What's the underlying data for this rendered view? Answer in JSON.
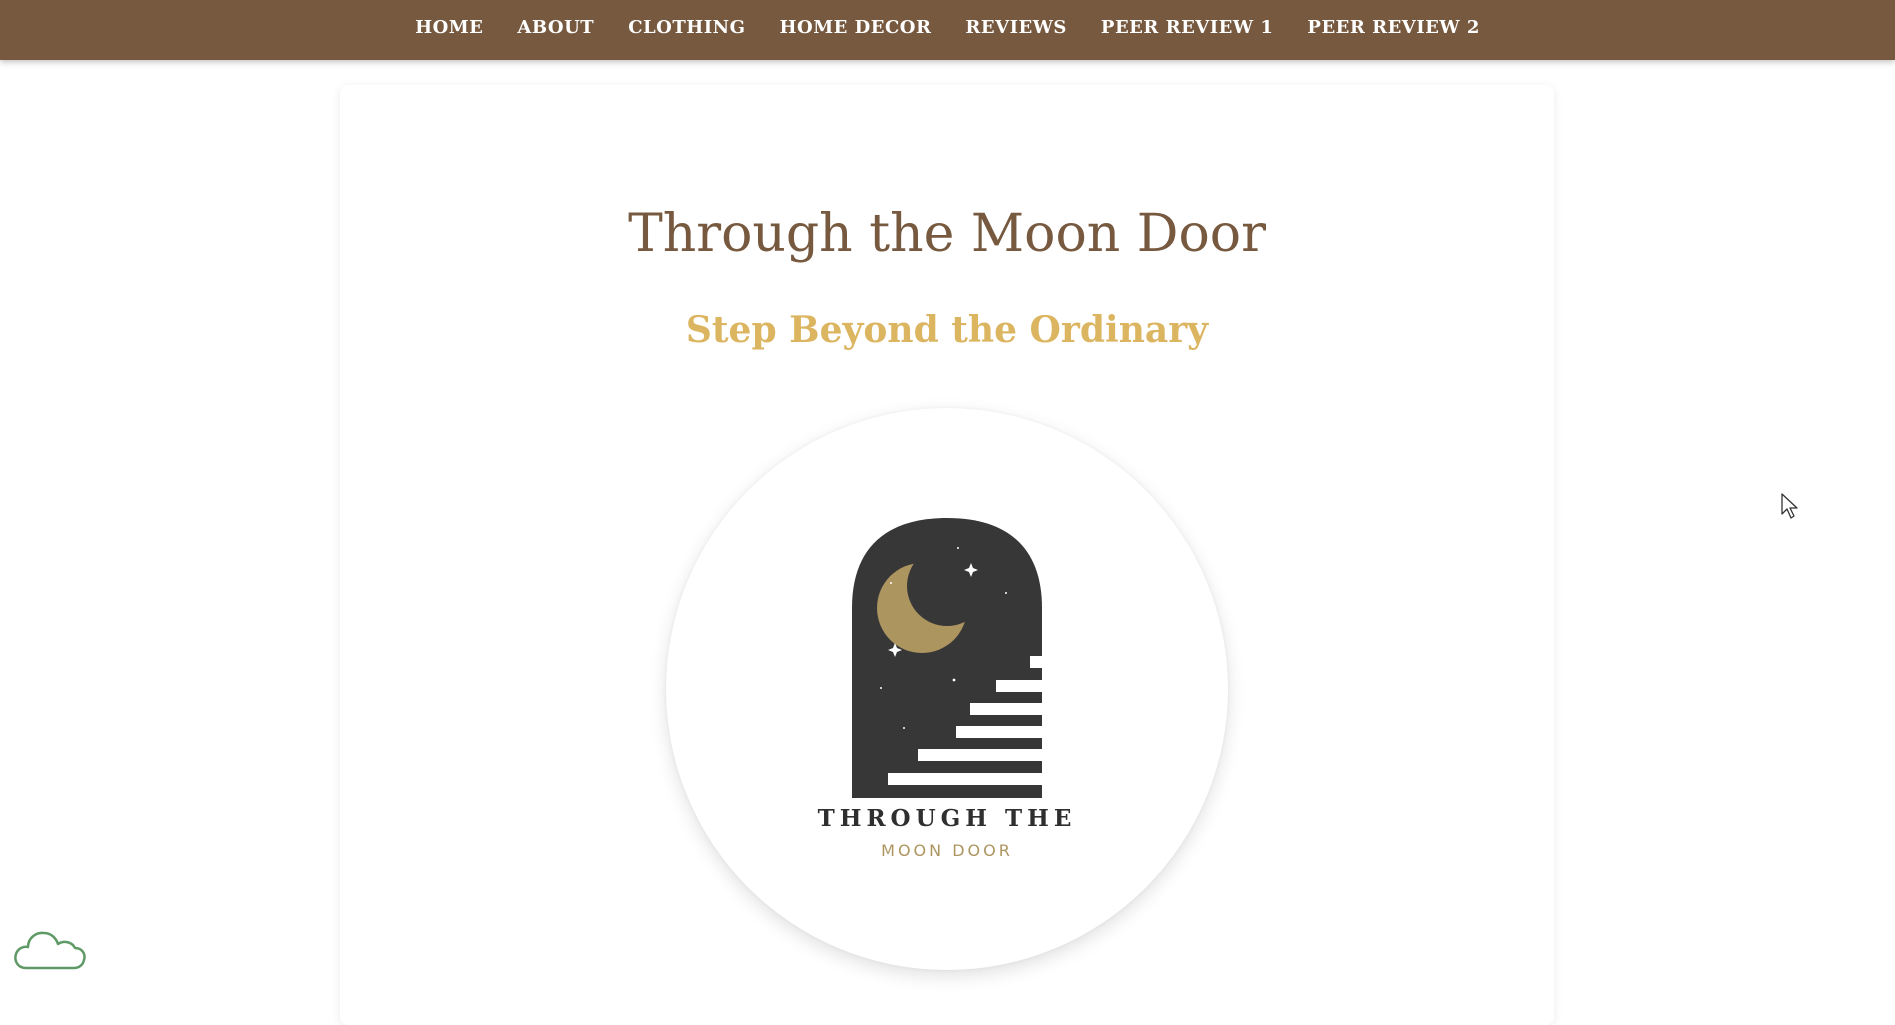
{
  "nav": {
    "items": [
      {
        "label": "HOME"
      },
      {
        "label": "ABOUT"
      },
      {
        "label": "CLOTHING"
      },
      {
        "label": "HOME DECOR"
      },
      {
        "label": "REVIEWS"
      },
      {
        "label": "PEER REVIEW 1"
      },
      {
        "label": "PEER REVIEW 2"
      }
    ]
  },
  "hero": {
    "title": "Through the Moon Door",
    "tagline": "Step Beyond the Ordinary"
  },
  "logo": {
    "line1": "THROUGH THE",
    "line2": "MOON DOOR",
    "icon": "moon-door-arch-icon"
  },
  "widgets": {
    "cloud_icon": "cloud-icon"
  },
  "colors": {
    "nav_bg": "#76593f",
    "title": "#76593f",
    "tagline": "#dcb561",
    "logo_dark": "#383737",
    "logo_gold": "#ad9560",
    "cloud": "#5e9966"
  }
}
